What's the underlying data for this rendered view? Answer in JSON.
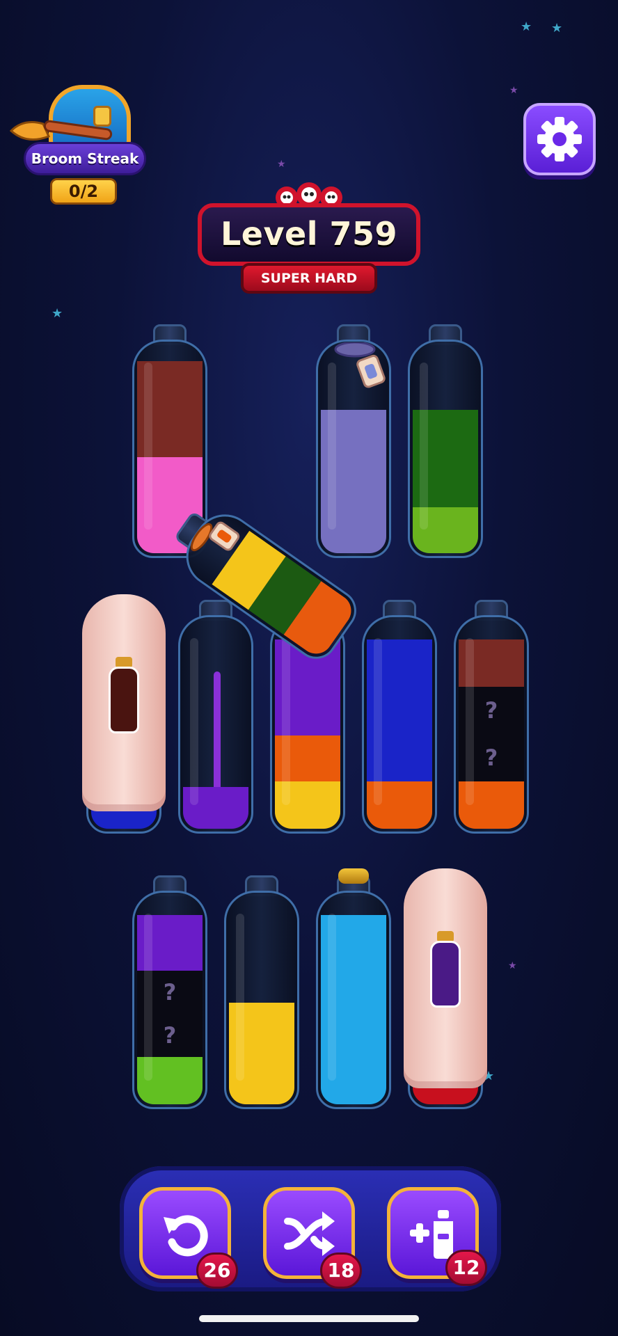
{
  "streak": {
    "title": "Broom Streak",
    "count": "0/2"
  },
  "level": {
    "title": "Level 759",
    "difficulty": "SUPER HARD"
  },
  "icons": {
    "settings": "gear-icon",
    "undo": "undo-icon",
    "shuffle": "shuffle-icon",
    "add_tube": "add-bottle-icon"
  },
  "tubes": [
    {
      "row": 1,
      "segments": [
        "#f25bc8",
        "#7a2a24"
      ]
    },
    {
      "row": 1,
      "segments": [
        "#7670c0"
      ],
      "tag": "tied-label"
    },
    {
      "row": 1,
      "segments": [
        "#6ab41e",
        "#1c6a12"
      ]
    },
    {
      "row": 1,
      "segments": [
        "#f4c51a",
        "#1c5a12",
        "#e85a0e"
      ],
      "state": "being-poured"
    },
    {
      "row": 2,
      "state": "covered",
      "hint_color": "#4a1410"
    },
    {
      "row": 2,
      "segments": [
        "#6a1cc8"
      ],
      "state": "pouring-stream"
    },
    {
      "row": 2,
      "segments": [
        "#f4c51a",
        "#ea5a0a",
        "#6a1cc8"
      ]
    },
    {
      "row": 2,
      "segments": [
        "#ea5a0a",
        "#1a24c8"
      ]
    },
    {
      "row": 2,
      "segments": [
        "#ea5a0a",
        "?",
        "?",
        "#7a2a24"
      ]
    },
    {
      "row": 3,
      "segments": [
        "#62c022",
        "?",
        "?",
        "#6a1cc8"
      ]
    },
    {
      "row": 3,
      "segments": [
        "#f4c51a"
      ]
    },
    {
      "row": 3,
      "segments": [
        "#22a8e8"
      ],
      "state": "corked"
    },
    {
      "row": 3,
      "state": "covered",
      "hint_color": "#4a1a86"
    }
  ],
  "powerups": {
    "undo_count": "26",
    "shuffle_count": "18",
    "add_tube_count": "12"
  }
}
